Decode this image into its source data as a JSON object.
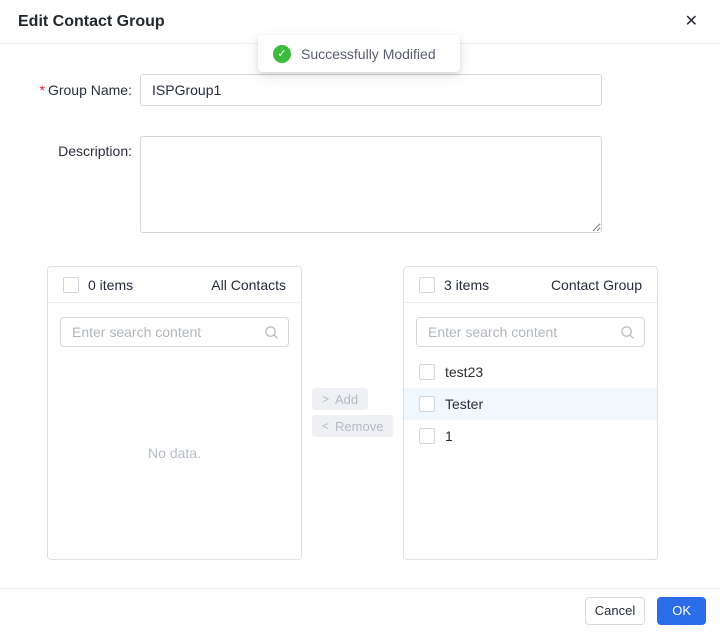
{
  "dialog": {
    "title": "Edit Contact Group"
  },
  "icons": {
    "close": "✕",
    "check": "✓",
    "add_arrow": ">",
    "remove_arrow": "<"
  },
  "toast": {
    "message": "Successfully Modified"
  },
  "form": {
    "required_mark": "*",
    "group_name": {
      "label": "Group Name:",
      "value": "ISPGroup1"
    },
    "description": {
      "label": "Description:",
      "value": ""
    }
  },
  "transfer": {
    "source": {
      "count": "0 items",
      "title": "All Contacts",
      "search_placeholder": "Enter search content",
      "empty_text": "No data."
    },
    "target": {
      "count": "3 items",
      "title": "Contact Group",
      "search_placeholder": "Enter search content",
      "items": [
        {
          "label": "test23",
          "selected": false
        },
        {
          "label": "Tester",
          "selected": true
        },
        {
          "label": "1",
          "selected": false
        }
      ]
    },
    "add_label": "Add",
    "remove_label": "Remove"
  },
  "footer": {
    "cancel_label": "Cancel",
    "ok_label": "OK"
  },
  "colors": {
    "primary_blue": "#2b6de9",
    "success_green": "#3dbb3d",
    "selected_row": "#f0f7fd"
  }
}
